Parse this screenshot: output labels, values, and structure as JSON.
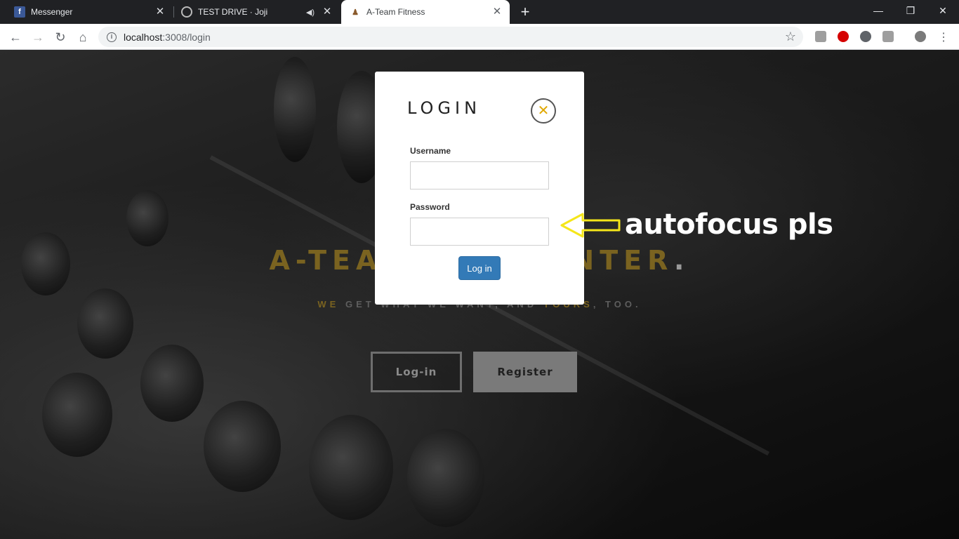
{
  "browser": {
    "tabs": [
      {
        "title": "Messenger",
        "favicon": "facebook-icon"
      },
      {
        "title": "TEST DRIVE · Joji",
        "favicon": "spotify-icon"
      },
      {
        "title": "A-Team Fitness",
        "favicon": "ateam-icon"
      }
    ],
    "active_tab": 2,
    "url_host": "localhost",
    "url_path": ":3008/login"
  },
  "hero": {
    "title_left": "A-TEA",
    "title_right": "NTER",
    "title_dot": ".",
    "sub_we": "WE",
    "sub_mid": " GET WHAT WE WANT, AND ",
    "sub_yours": "YOURS",
    "sub_end": ", TOO.",
    "login_label": "Log-in",
    "register_label": "Register"
  },
  "modal": {
    "title": "LOGIN",
    "username_label": "Username",
    "password_label": "Password",
    "submit_label": "Log in"
  },
  "annotation": {
    "text": "autofocus pls"
  },
  "colors": {
    "gold": "#7a6320",
    "close_x": "#e0a800",
    "submit": "#337ab7",
    "arrow": "#f5e61a"
  }
}
